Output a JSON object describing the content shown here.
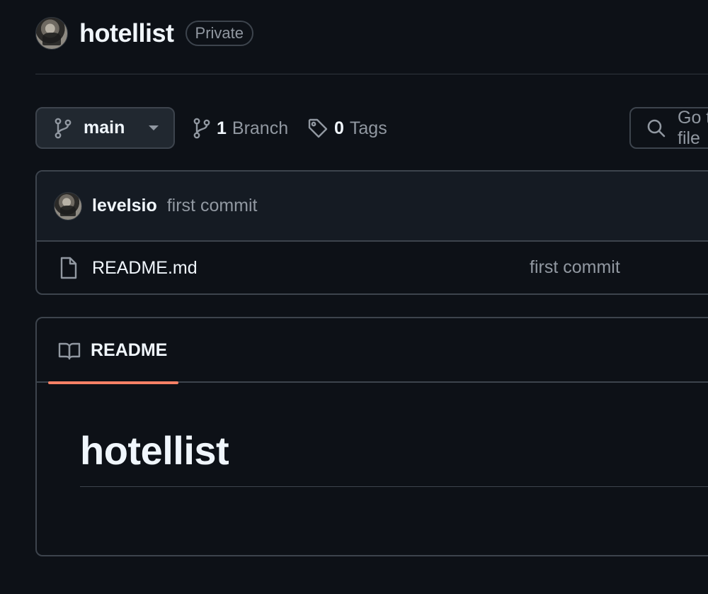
{
  "repo": {
    "name": "hotellist",
    "visibility": "Private"
  },
  "toolbar": {
    "branch_selector": "main",
    "branches_count": "1",
    "branches_label": "Branch",
    "tags_count": "0",
    "tags_label": "Tags",
    "go_to_file_placeholder": "Go to file"
  },
  "latest_commit": {
    "author": "levelsio",
    "message": "first commit"
  },
  "files": [
    {
      "name": "README.md",
      "commit_message": "first commit",
      "icon": "file-icon"
    }
  ],
  "readme": {
    "tab_label": "README",
    "heading": "hotellist"
  },
  "colors": {
    "background": "#0d1117",
    "border": "#3d444d",
    "muted_text": "#9198a1",
    "text": "#f0f6fc",
    "tab_underline": "#f78166",
    "button_bg": "#212830",
    "commit_bar_bg": "#151b23"
  }
}
